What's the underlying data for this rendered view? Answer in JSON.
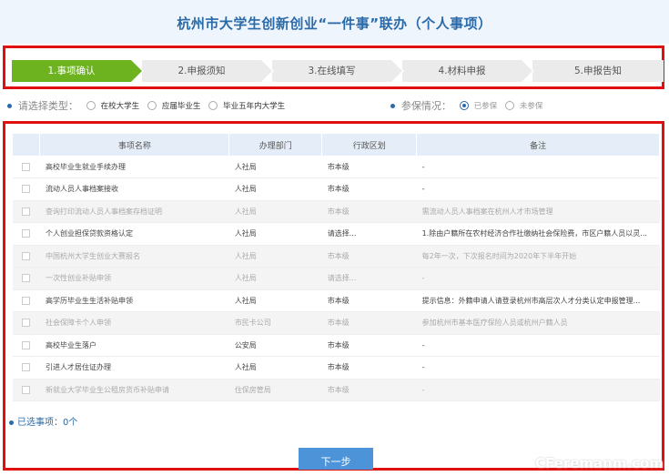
{
  "header": {
    "title": "杭州市大学生创新创业“一件事”联办（个人事项）"
  },
  "steps": [
    {
      "label": "1.事项确认",
      "active": true
    },
    {
      "label": "2.申报须知",
      "active": false
    },
    {
      "label": "3.在线填写",
      "active": false
    },
    {
      "label": "4.材料申报",
      "active": false
    },
    {
      "label": "5.申报告知",
      "active": false
    }
  ],
  "filters": {
    "type_label": "请选择类型：",
    "type_options": [
      "在校大学生",
      "应届毕业生",
      "毕业五年内大学生"
    ],
    "insurance_label": "参保情况：",
    "insurance_options": [
      "已参保",
      "未参保"
    ],
    "insurance_selected": "已参保"
  },
  "table": {
    "headers": [
      "事项名称",
      "办理部门",
      "行政区划",
      "备注"
    ],
    "rows": [
      {
        "name": "高校毕业生就业手续办理",
        "dept": "人社局",
        "region": "市本级",
        "note": "-",
        "disabled": false
      },
      {
        "name": "流动人员人事档案接收",
        "dept": "人社局",
        "region": "市本级",
        "note": "-",
        "disabled": false
      },
      {
        "name": "查询打印流动人员人事档案存档证明",
        "dept": "人社局",
        "region": "市本级",
        "note": "需流动人员人事档案在杭州人才市场管理",
        "disabled": true
      },
      {
        "name": "个人创业担保贷款资格认定",
        "dept": "人社局",
        "region": "请选择...",
        "note": "1.除由户籍所在农村经济合作社缴纳社会保险费，市区户籍人员以灵...",
        "disabled": false
      },
      {
        "name": "中国杭州大学生创业大赛报名",
        "dept": "人社局",
        "region": "市本级",
        "note": "每2年一次，下次报名时间为2020年下半年开始",
        "disabled": true
      },
      {
        "name": "一次性创业补贴申领",
        "dept": "人社局",
        "region": "请选择...",
        "note": "-",
        "disabled": true
      },
      {
        "name": "高学历毕业生生活补贴申领",
        "dept": "人社局",
        "region": "市本级",
        "note": "提示信息：外籍申请人请登录杭州市高层次人才分类认定申报管理...",
        "disabled": false
      },
      {
        "name": "社会保障卡个人申领",
        "dept": "市民卡公司",
        "region": "市本级",
        "note": "参加杭州市基本医疗保险人员或杭州户籍人员",
        "disabled": true
      },
      {
        "name": "高校毕业生落户",
        "dept": "公安局",
        "region": "市本级",
        "note": "-",
        "disabled": false
      },
      {
        "name": "引进人才居住证办理",
        "dept": "人社局",
        "region": "市本级",
        "note": "-",
        "disabled": false
      },
      {
        "name": "新就业大学毕业生公租房货币补贴申请",
        "dept": "住保房管局",
        "region": "市本级",
        "note": "-",
        "disabled": true
      }
    ]
  },
  "footer": {
    "selected_label": "已选事项：0个",
    "next_button": "下一步",
    "watermark": "CFeremanm.com"
  },
  "colors": {
    "accent": "#2a6aa8",
    "step_active": "#6cb31f",
    "highlight_border": "#e01010",
    "button": "#4d93d8"
  }
}
